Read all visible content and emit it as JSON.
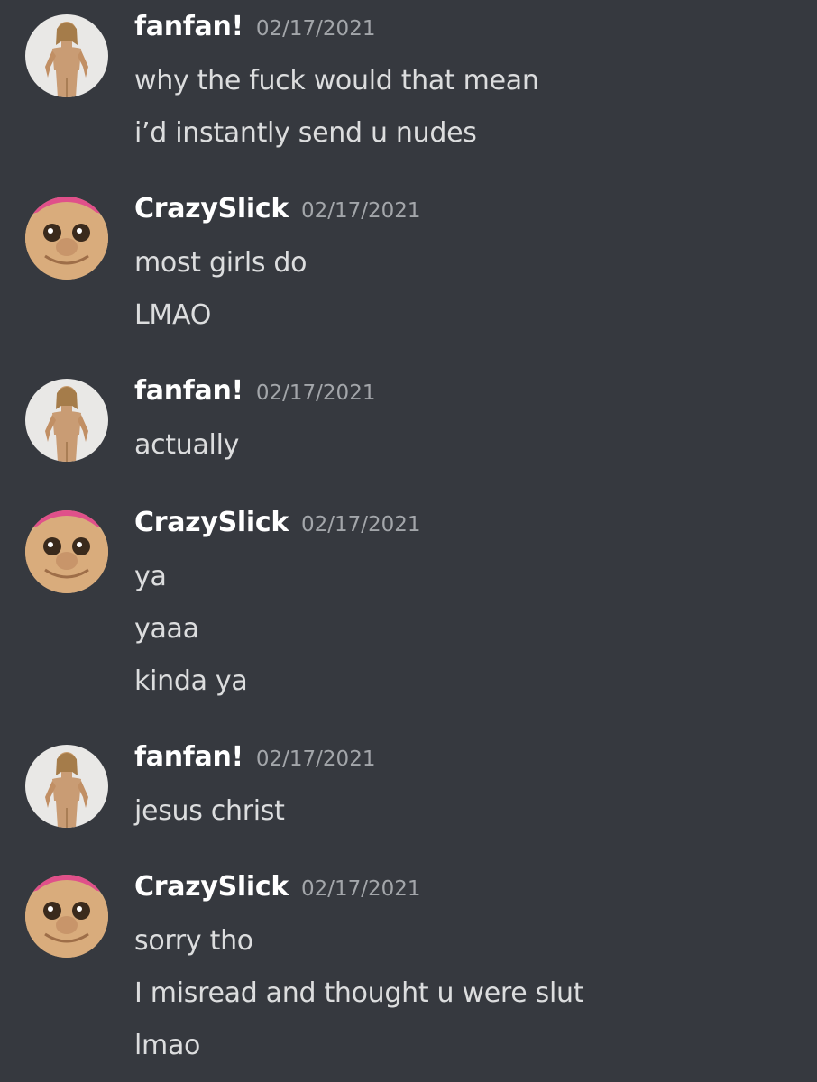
{
  "messages": [
    {
      "author": "fanfan!",
      "avatar": "doll-figure-avatar",
      "timestamp": "02/17/2021",
      "lines": [
        "why the fuck would that mean",
        "i’d instantly send u nudes"
      ]
    },
    {
      "author": "CrazySlick",
      "avatar": "troll-doll-avatar",
      "timestamp": "02/17/2021",
      "lines": [
        "most girls do",
        "LMAO"
      ]
    },
    {
      "author": "fanfan!",
      "avatar": "doll-figure-avatar",
      "timestamp": "02/17/2021",
      "lines": [
        "actually"
      ]
    },
    {
      "author": "CrazySlick",
      "avatar": "troll-doll-avatar",
      "timestamp": "02/17/2021",
      "lines": [
        "ya",
        "yaaa",
        "kinda ya"
      ]
    },
    {
      "author": "fanfan!",
      "avatar": "doll-figure-avatar",
      "timestamp": "02/17/2021",
      "lines": [
        "jesus christ"
      ]
    },
    {
      "author": "CrazySlick",
      "avatar": "troll-doll-avatar",
      "timestamp": "02/17/2021",
      "lines": [
        "sorry tho",
        "I misread and thought u were slut",
        "lmao"
      ]
    }
  ],
  "colors": {
    "background": "#36393f",
    "username": "#ffffff",
    "timestamp": "#a3a6aa",
    "text": "#dcddde"
  }
}
